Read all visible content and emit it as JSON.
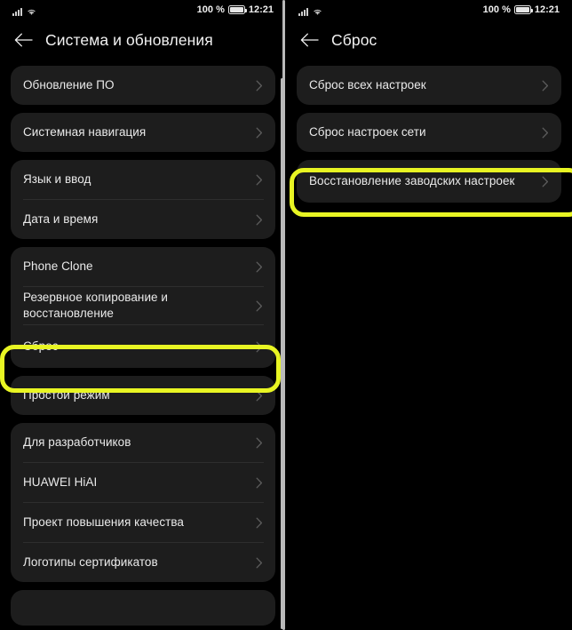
{
  "meta": {
    "accent_highlight_color": "#e8f523",
    "card_background": "#1d1d1d",
    "screen_background": "#000000"
  },
  "status_bar": {
    "battery_percent": "100 %",
    "time": "12:21",
    "signal_icon": "signal-bars-icon",
    "wifi_icon": "wifi-icon",
    "battery_icon": "battery-full-icon"
  },
  "screens": [
    {
      "id": "system-and-updates",
      "title": "Система и обновления",
      "back_icon": "back-arrow-icon",
      "groups": [
        {
          "id": "group-software-update",
          "items": [
            {
              "label": "Обновление ПО",
              "highlighted": false
            }
          ]
        },
        {
          "id": "group-system-navigation",
          "items": [
            {
              "label": "Системная навигация",
              "highlighted": false
            }
          ]
        },
        {
          "id": "group-language-datetime",
          "items": [
            {
              "label": "Язык и ввод",
              "highlighted": false
            },
            {
              "label": "Дата и время",
              "highlighted": false
            }
          ]
        },
        {
          "id": "group-clone-backup-reset",
          "items": [
            {
              "label": "Phone Clone",
              "highlighted": false
            },
            {
              "label": "Резервное копирование и восстановление",
              "highlighted": false
            },
            {
              "label": "Сброс",
              "highlighted": true
            }
          ]
        },
        {
          "id": "group-simple-mode",
          "items": [
            {
              "label": "Простой режим",
              "highlighted": false
            }
          ]
        },
        {
          "id": "group-developer-misc",
          "items": [
            {
              "label": "Для разработчиков",
              "highlighted": false
            },
            {
              "label": "HUAWEI HiAI",
              "highlighted": false
            },
            {
              "label": "Проект повышения качества",
              "highlighted": false
            },
            {
              "label": "Логотипы сертификатов",
              "highlighted": false
            }
          ]
        },
        {
          "id": "group-partial-bottom",
          "items": []
        }
      ]
    },
    {
      "id": "reset",
      "title": "Сброс",
      "back_icon": "back-arrow-icon",
      "groups": [
        {
          "id": "group-reset-all-settings",
          "items": [
            {
              "label": "Сброс всех настроек",
              "highlighted": false
            }
          ]
        },
        {
          "id": "group-reset-network",
          "items": [
            {
              "label": "Сброс настроек сети",
              "highlighted": false
            }
          ]
        },
        {
          "id": "group-factory-reset",
          "items": [
            {
              "label": "Восстановление заводских настроек",
              "highlighted": true
            }
          ]
        }
      ]
    }
  ]
}
